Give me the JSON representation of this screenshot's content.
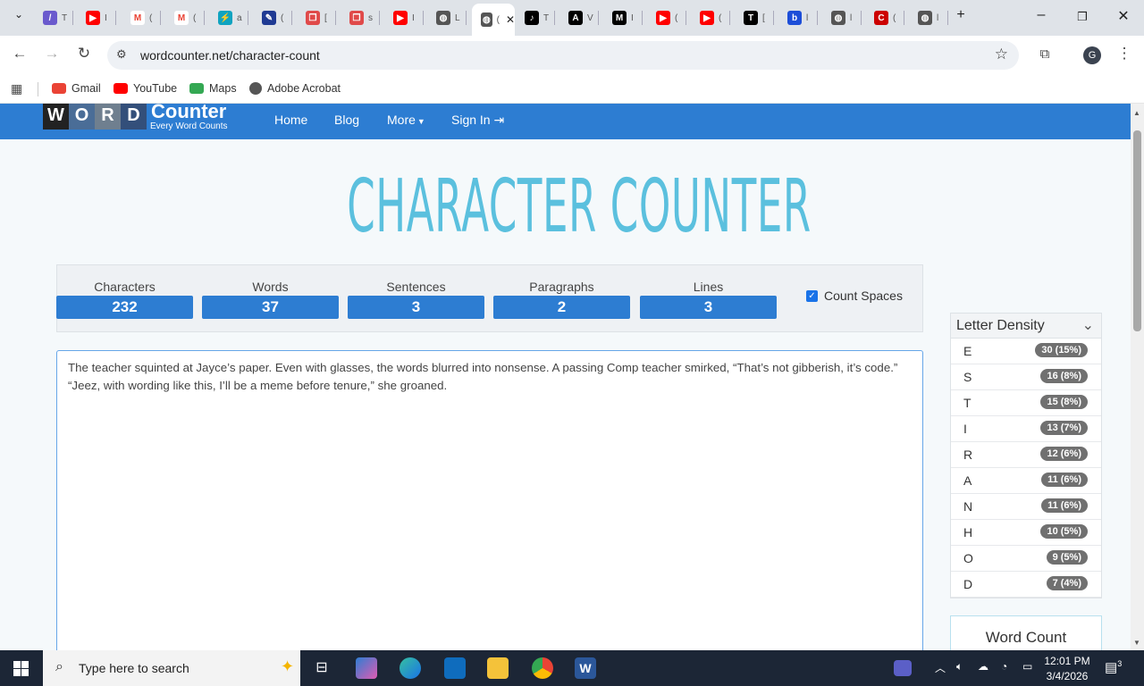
{
  "browser": {
    "tabs": [
      {
        "icon": "feather-icon",
        "color": "#6a5acd",
        "glyph": "/",
        "title": "T"
      },
      {
        "icon": "youtube-icon",
        "color": "#ff0000",
        "glyph": "▶",
        "title": "I"
      },
      {
        "icon": "gmail-icon",
        "color": "#ffffff",
        "glyph": "M",
        "title": "("
      },
      {
        "icon": "gmail-icon",
        "color": "#ffffff",
        "glyph": "M",
        "title": "("
      },
      {
        "icon": "docs-icon",
        "color": "#0fa3c0",
        "glyph": "⚡",
        "title": "a"
      },
      {
        "icon": "canvas-icon",
        "color": "#1f3a93",
        "glyph": "✎",
        "title": "("
      },
      {
        "icon": "book-icon",
        "color": "#e04a4a",
        "glyph": "❐",
        "title": "["
      },
      {
        "icon": "book-icon",
        "color": "#e04a4a",
        "glyph": "❐",
        "title": "s"
      },
      {
        "icon": "youtube-icon",
        "color": "#ff0000",
        "glyph": "▶",
        "title": "I"
      },
      {
        "icon": "globe-icon",
        "color": "#555555",
        "glyph": "◍",
        "title": "L"
      },
      {
        "icon": "globe-icon",
        "color": "#555555",
        "glyph": "◍",
        "title": "("
      },
      {
        "icon": "tiktok-icon",
        "color": "#000000",
        "glyph": "♪",
        "title": "T"
      },
      {
        "icon": "a-logo-icon",
        "color": "#000000",
        "glyph": "A",
        "title": "V"
      },
      {
        "icon": "medium-icon",
        "color": "#000000",
        "glyph": "M",
        "title": "I"
      },
      {
        "icon": "youtube-icon",
        "color": "#ff0000",
        "glyph": "▶",
        "title": "("
      },
      {
        "icon": "youtube-icon",
        "color": "#ff0000",
        "glyph": "▶",
        "title": "("
      },
      {
        "icon": "tt-icon",
        "color": "#000000",
        "glyph": "T",
        "title": "["
      },
      {
        "icon": "b-logo-icon",
        "color": "#1d4ed8",
        "glyph": "b",
        "title": "l"
      },
      {
        "icon": "globe-icon",
        "color": "#555555",
        "glyph": "◍",
        "title": "l"
      },
      {
        "icon": "cnn-icon",
        "color": "#cc0000",
        "glyph": "C",
        "title": "("
      },
      {
        "icon": "globe-icon",
        "color": "#555555",
        "glyph": "◍",
        "title": "l"
      }
    ],
    "new_tab": "+",
    "url": "wordcounter.net/character-count",
    "bookmarks": [
      "Gmail",
      "YouTube",
      "Maps",
      "Adobe Acrobat"
    ],
    "profile_initial": "G"
  },
  "site": {
    "logo_letters": [
      "W",
      "O",
      "R",
      "D"
    ],
    "logo_colors": [
      "#222222",
      "#4a6d97",
      "#6f7f8f",
      "#334f7a"
    ],
    "logo_word": "Counter",
    "logo_slogan": "Every Word Counts",
    "nav": {
      "home": "Home",
      "blog": "Blog",
      "more": "More",
      "signin": "Sign In"
    },
    "title": "CHARACTER COUNTER",
    "stats": [
      {
        "label": "Characters",
        "value": "232"
      },
      {
        "label": "Words",
        "value": "37"
      },
      {
        "label": "Sentences",
        "value": "3"
      },
      {
        "label": "Paragraphs",
        "value": "2"
      },
      {
        "label": "Lines",
        "value": "3"
      }
    ],
    "count_spaces_label": "Count Spaces",
    "editor_line1": "The teacher squinted at Jayce’s paper. Even with glasses, the words blurred into nonsense. A passing Comp teacher smirked, “That’s not gibberish, it’s code.”",
    "editor_line2": "“Jeez, with wording like this, I’ll be a meme before tenure,” she groaned.",
    "density_title": "Letter Density",
    "density": [
      {
        "letter": "E",
        "badge": "30 (15%)"
      },
      {
        "letter": "S",
        "badge": "16 (8%)"
      },
      {
        "letter": "T",
        "badge": "15 (8%)"
      },
      {
        "letter": "I",
        "badge": "13 (7%)"
      },
      {
        "letter": "R",
        "badge": "12 (6%)"
      },
      {
        "letter": "A",
        "badge": "11 (6%)"
      },
      {
        "letter": "N",
        "badge": "11 (6%)"
      },
      {
        "letter": "H",
        "badge": "10 (5%)"
      },
      {
        "letter": "O",
        "badge": "9 (5%)"
      },
      {
        "letter": "D",
        "badge": "7 (4%)"
      }
    ],
    "word_count_label": "Word Count",
    "accent": "#2d7dd2"
  },
  "taskbar": {
    "search_placeholder": "Type here to search",
    "time": "12:01 PM",
    "date": "3/4/2026",
    "notifications": "3"
  }
}
